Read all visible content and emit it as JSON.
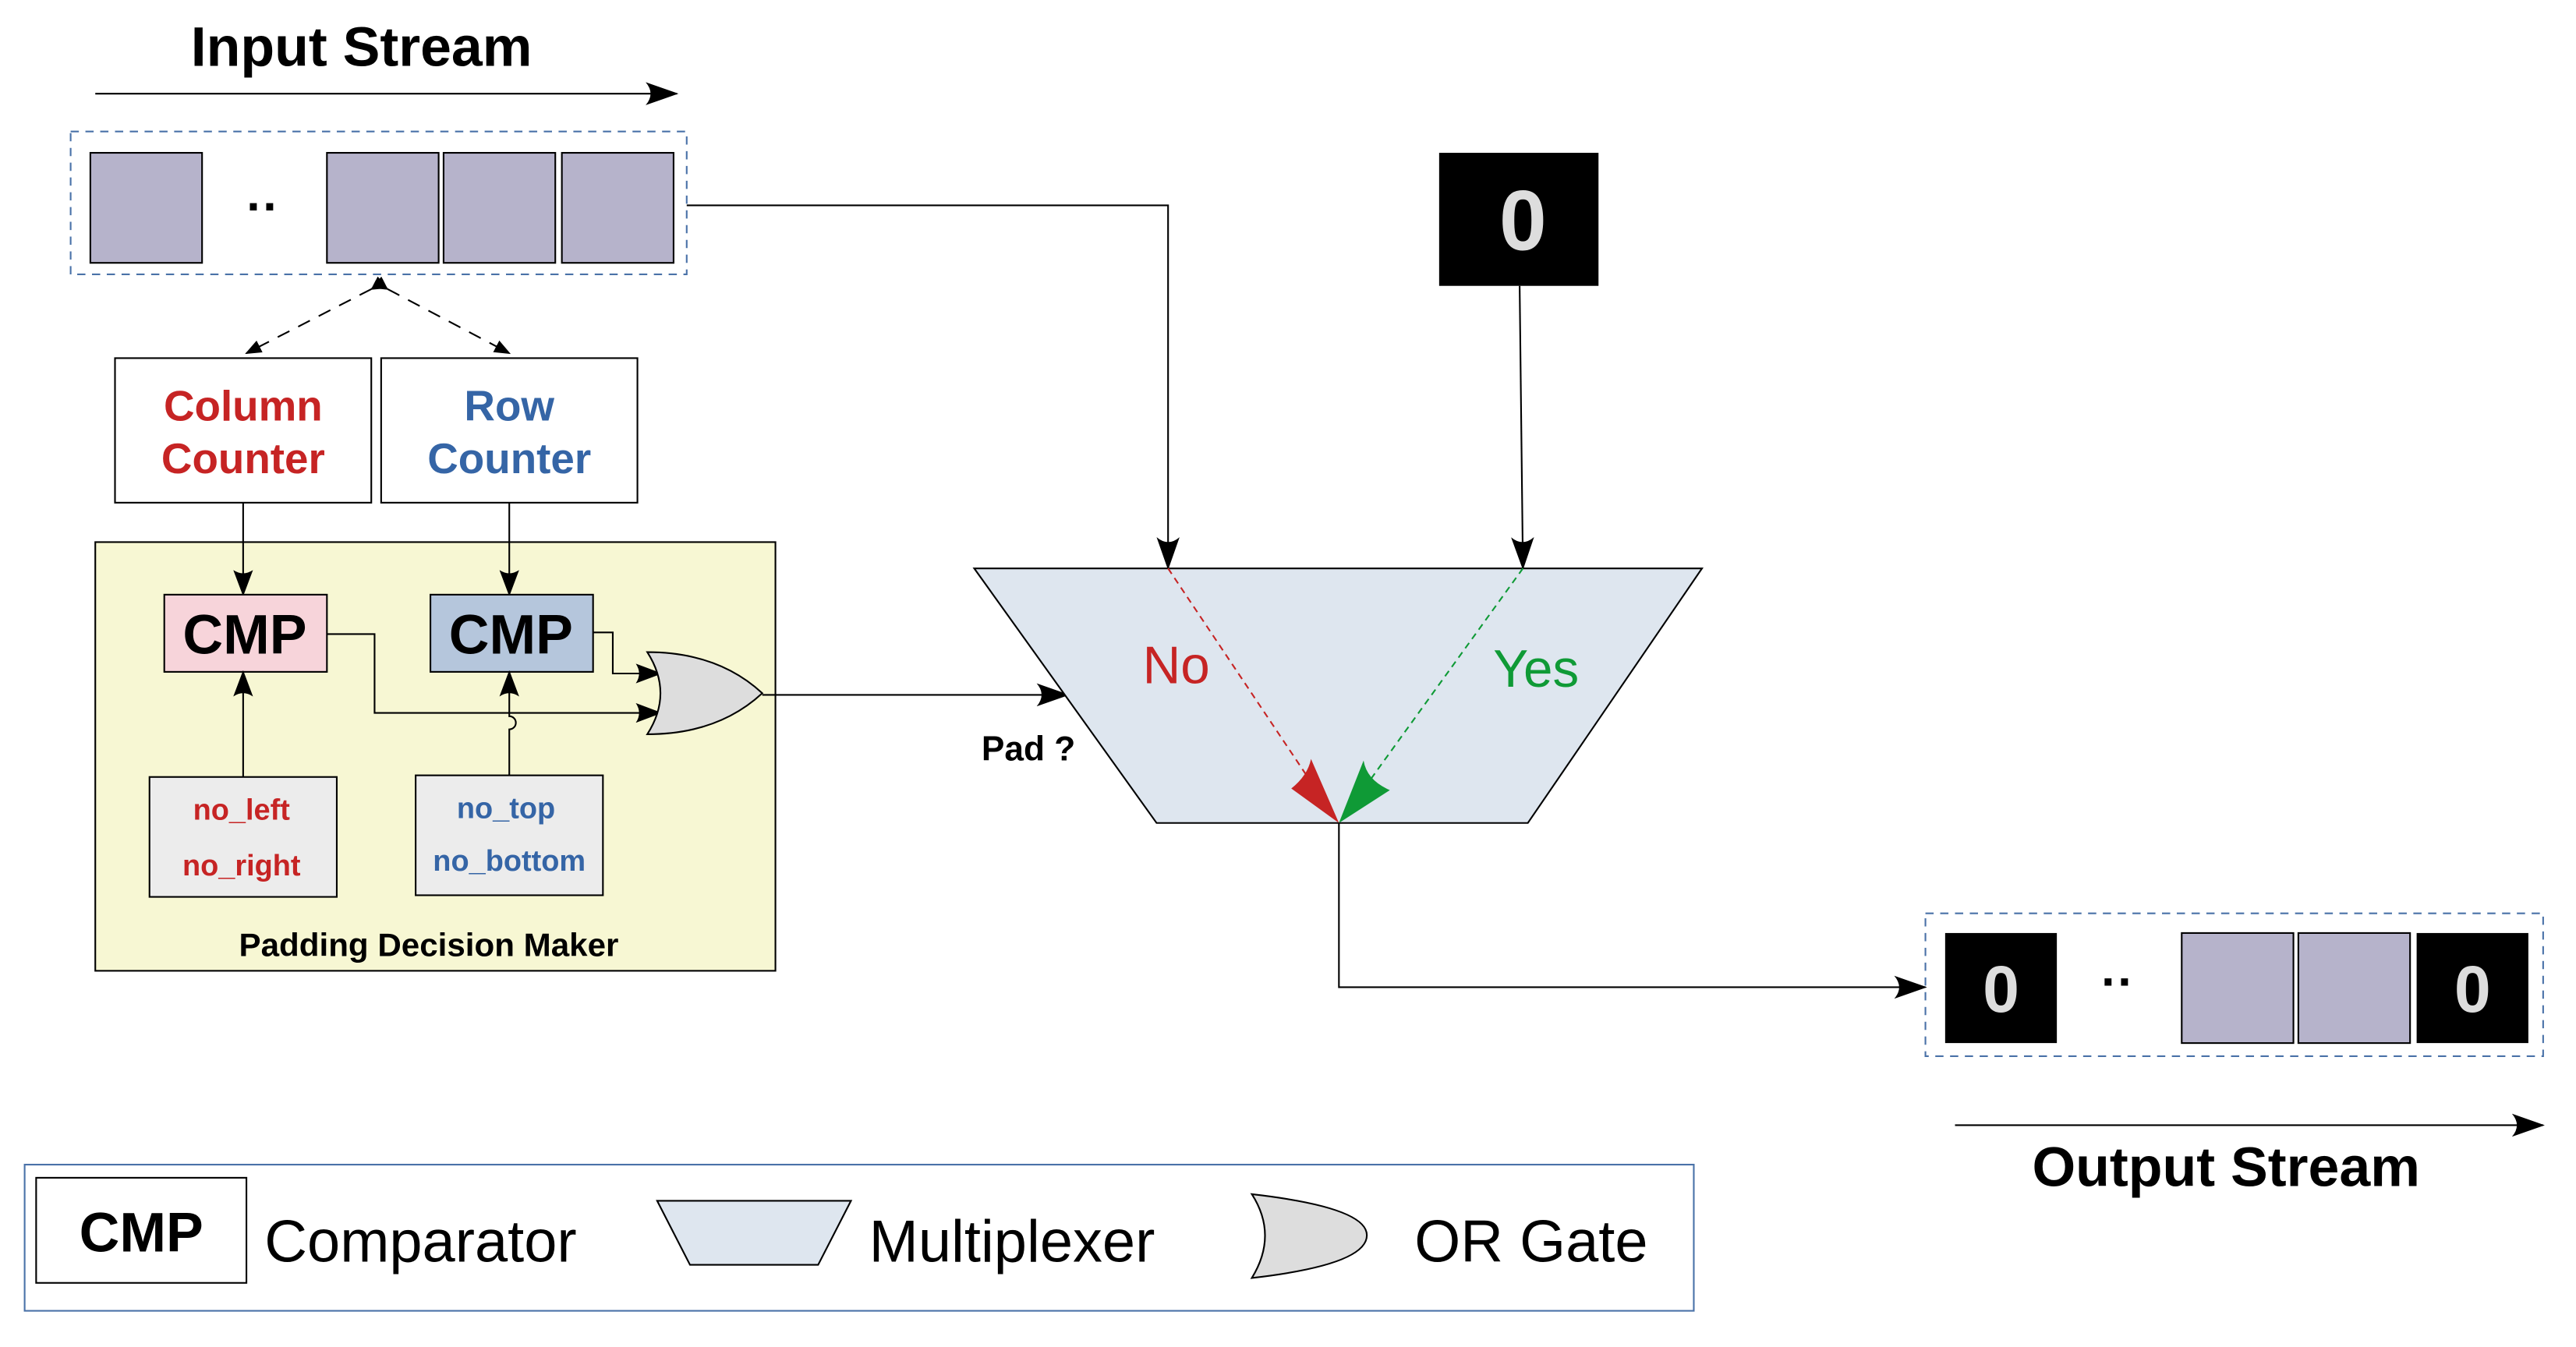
{
  "input_stream": {
    "title": "Input Stream",
    "ellipsis": "··",
    "cell_color": "#b6b3cb"
  },
  "counters": {
    "column": {
      "line1": "Column",
      "line2": "Counter",
      "color": "#c62424"
    },
    "row": {
      "line1": "Row",
      "line2": "Counter",
      "color": "#3565a6"
    }
  },
  "padding_decision_maker": {
    "title": "Padding Decision Maker",
    "background": "#f7f7d3",
    "cmp_left": {
      "label": "CMP",
      "fill": "#f7d4da"
    },
    "cmp_right": {
      "label": "CMP",
      "fill": "#b5c6dc"
    },
    "params_left": {
      "line1": "no_left",
      "line2": "no_right",
      "color": "#c62424"
    },
    "params_right": {
      "line1": "no_top",
      "line2": "no_bottom",
      "color": "#3565a6"
    }
  },
  "zero_constant": {
    "label": "0",
    "text_color": "#dddddd"
  },
  "multiplexer": {
    "select_label": "Pad ?",
    "no_label": "No",
    "yes_label": "Yes",
    "fill": "#dee6ef",
    "no_color": "#c62424",
    "yes_color": "#0f9a36"
  },
  "output_stream": {
    "title": "Output Stream",
    "ellipsis": "··",
    "cells": [
      "0",
      "",
      "",
      "0"
    ]
  },
  "legend": {
    "cmp_symbol": "CMP",
    "cmp_label": "Comparator",
    "mux_label": "Multiplexer",
    "or_label": "OR Gate"
  }
}
